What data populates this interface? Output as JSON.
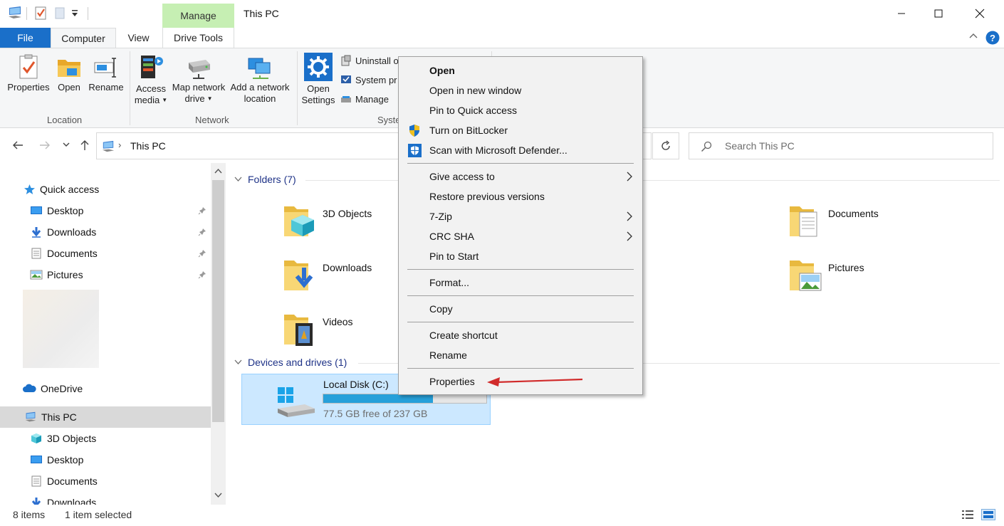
{
  "window": {
    "title": "This PC",
    "contextual_tab_group": "Manage"
  },
  "tabs": {
    "file": "File",
    "computer": "Computer",
    "view": "View",
    "drive_tools": "Drive Tools"
  },
  "ribbon": {
    "location": {
      "label": "Location",
      "properties": "Properties",
      "open": "Open",
      "rename": "Rename"
    },
    "network": {
      "label": "Network",
      "access_media_1": "Access",
      "access_media_2": "media",
      "map_drive_1": "Map network",
      "map_drive_2": "drive",
      "add_location_1": "Add a network",
      "add_location_2": "location"
    },
    "system": {
      "label": "Syste",
      "open_settings_1": "Open",
      "open_settings_2": "Settings",
      "uninstall": "Uninstall o",
      "system_props": "System pr",
      "manage": "Manage"
    }
  },
  "address": {
    "path": "This PC",
    "search_placeholder": "Search This PC"
  },
  "nav": {
    "quick_access": "Quick access",
    "qa_items": [
      "Desktop",
      "Downloads",
      "Documents",
      "Pictures"
    ],
    "onedrive": "OneDrive",
    "this_pc": "This PC",
    "pc_items": [
      "3D Objects",
      "Desktop",
      "Documents",
      "Downloads"
    ]
  },
  "content": {
    "folders_header": "Folders (7)",
    "folders": [
      "3D Objects",
      "Documents",
      "Downloads",
      "Pictures",
      "Videos"
    ],
    "drives_header": "Devices and drives (1)",
    "drive": {
      "name": "Local Disk (C:)",
      "free": "77.5 GB free of 237 GB",
      "used_fraction": 0.673
    }
  },
  "context_menu": {
    "items": [
      "Open",
      "Open in new window",
      "Pin to Quick access",
      "Turn on BitLocker",
      "Scan with Microsoft Defender...",
      "Give access to",
      "Restore previous versions",
      "7-Zip",
      "CRC SHA",
      "Pin to Start",
      "Format...",
      "Copy",
      "Create shortcut",
      "Rename",
      "Properties"
    ]
  },
  "status": {
    "items": "8 items",
    "selected": "1 item selected"
  },
  "colors": {
    "accent": "#1a6fc9",
    "selection": "#cce8ff",
    "drive_bar": "#26a0da",
    "annotation_arrow": "#d12b2b",
    "manage_tab": "#c6efb3"
  }
}
